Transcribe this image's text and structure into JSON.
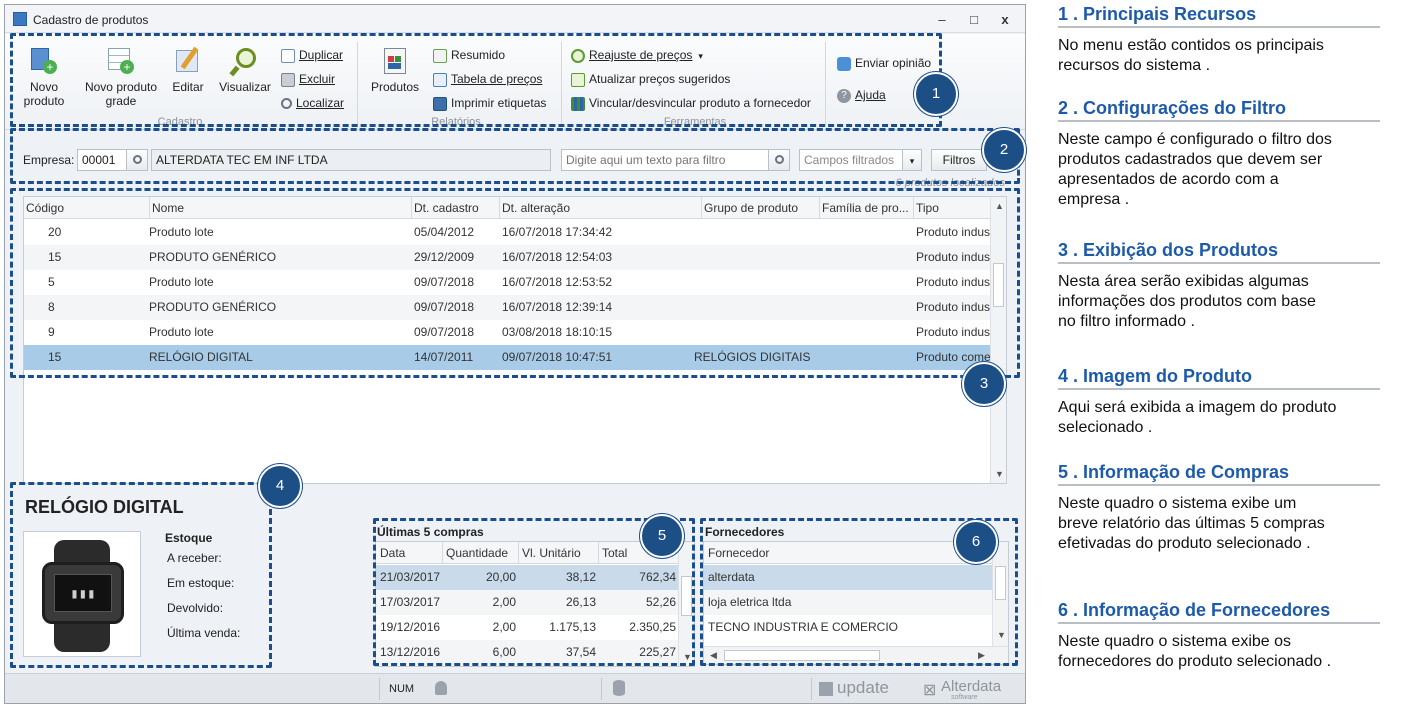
{
  "window": {
    "title": "Cadastro de produtos",
    "minimize": "–",
    "maximize": "□",
    "close": "x"
  },
  "ribbon": {
    "cadastro": {
      "novo_produto": [
        "Novo",
        "produto"
      ],
      "novo_produto_grade": [
        "Novo produto",
        "grade"
      ],
      "editar": "Editar",
      "visualizar": "Visualizar",
      "duplicar": "Duplicar",
      "excluir": "Excluir",
      "localizar": "Localizar",
      "group_label": "Cadastro"
    },
    "relatorios": {
      "produtos": "Produtos",
      "resumido": "Resumido",
      "tabela_precos": "Tabela de preços",
      "imprimir_etiquetas": "Imprimir etiquetas",
      "group_label": "Relatórios"
    },
    "ferramentas": {
      "reajuste": "Reajuste de preços",
      "atualizar": "Atualizar preços sugeridos",
      "vincular": "Vincular/desvincular produto a fornecedor",
      "group_label": "Ferramentas"
    },
    "extra": {
      "enviar_opiniao": "Enviar opinião",
      "ajuda": "Ajuda"
    }
  },
  "filter": {
    "empresa_label": "Empresa:",
    "empresa_code": "00001",
    "empresa_name": "ALTERDATA TEC EM INF LTDA",
    "search_placeholder": "Digite aqui um texto para filtro",
    "campos_filtrados": "Campos filtrados",
    "filtros_button": "Filtros",
    "count_text": "6 produtos localizados"
  },
  "grid": {
    "columns": [
      "Código",
      "Nome",
      "Dt. cadastro",
      "Dt. alteração",
      "Grupo de produto",
      "Família de pro...",
      "Tipo"
    ],
    "rows": [
      {
        "codigo": "20",
        "nome": "Produto lote",
        "cadastro": "05/04/2012",
        "alteracao": "16/07/2018 17:34:42",
        "grupo": "",
        "familia": "",
        "tipo": "Produto indus"
      },
      {
        "codigo": "15",
        "nome": "PRODUTO GENÉRICO",
        "cadastro": "29/12/2009",
        "alteracao": "16/07/2018 12:54:03",
        "grupo": "",
        "familia": "",
        "tipo": "Produto indus"
      },
      {
        "codigo": "5",
        "nome": "Produto lote",
        "cadastro": "09/07/2018",
        "alteracao": "16/07/2018 12:53:52",
        "grupo": "",
        "familia": "",
        "tipo": "Produto indus"
      },
      {
        "codigo": "8",
        "nome": "PRODUTO GENÉRICO",
        "cadastro": "09/07/2018",
        "alteracao": "16/07/2018 12:39:14",
        "grupo": "",
        "familia": "",
        "tipo": "Produto indus"
      },
      {
        "codigo": "9",
        "nome": "Produto lote",
        "cadastro": "09/07/2018",
        "alteracao": "03/08/2018 18:10:15",
        "grupo": "",
        "familia": "",
        "tipo": "Produto indus"
      },
      {
        "codigo": "15",
        "nome": "RELÓGIO DIGITAL",
        "cadastro": "14/07/2011",
        "alteracao": "09/07/2018 10:47:51",
        "grupo": "RELÓGIOS DIGITAIS",
        "familia": "",
        "tipo": "Produto come"
      }
    ]
  },
  "product": {
    "name": "RELÓGIO DIGITAL",
    "estoque_title": "Estoque",
    "a_receber": "A receber:",
    "em_estoque": "Em estoque:",
    "devolvido": "Devolvido:",
    "ultima_venda": "Última venda:"
  },
  "compras": {
    "title": "Últimas 5 compras",
    "columns": [
      "Data",
      "Quantidade",
      "Vl. Unitário",
      "Total"
    ],
    "rows": [
      {
        "data": "21/03/2017",
        "qtd": "20,00",
        "unit": "38,12",
        "total": "762,34"
      },
      {
        "data": "17/03/2017",
        "qtd": "2,00",
        "unit": "26,13",
        "total": "52,26"
      },
      {
        "data": "19/12/2016",
        "qtd": "2,00",
        "unit": "1.175,13",
        "total": "2.350,25"
      },
      {
        "data": "13/12/2016",
        "qtd": "6,00",
        "unit": "37,54",
        "total": "225,27"
      }
    ]
  },
  "fornecedores": {
    "title": "Fornecedores",
    "column": "Fornecedor",
    "rows": [
      "alterdata",
      "loja eletrica ltda",
      "TECNO INDUSTRIA E COMERCIO"
    ]
  },
  "status": {
    "num": "NUM",
    "update_logo": "update",
    "alterdata_logo": "Alterdata",
    "alterdata_sub": "software"
  },
  "bubbles": [
    "1",
    "2",
    "3",
    "4",
    "5",
    "6"
  ],
  "legend": [
    {
      "title": "1 . Principais Recursos",
      "text": [
        "No menu estão contidos os principais",
        "recursos  do sistema ."
      ]
    },
    {
      "title": "2 . Configurações do Filtro",
      "text": [
        "Neste campo é configurado o filtro dos",
        "produtos cadastrados  que devem ser",
        "apresentados de acordo com a",
        "empresa ."
      ]
    },
    {
      "title": "3 . Exibição dos Produtos",
      "text": [
        "Nesta área serão exibidas algumas",
        "informações dos produtos com base",
        "no filtro informado ."
      ]
    },
    {
      "title": "4 . Imagem do Produto",
      "text": [
        "Aqui será exibida a imagem do produto",
        "selecionado ."
      ]
    },
    {
      "title": "5 . Informação de Compras",
      "text": [
        "Neste  quadro o sistema exibe um",
        "breve relatório das últimas 5 compras",
        "efetivadas do produto selecionado ."
      ]
    },
    {
      "title": "6 . Informação de Fornecedores",
      "text": [
        "Neste quadro o sistema exibe os",
        "fornecedores  do produto selecionado ."
      ]
    }
  ],
  "colors": {
    "accent": "#1d4f87",
    "legend_title": "#1d5aa8",
    "selection": "#a8cbe8"
  }
}
